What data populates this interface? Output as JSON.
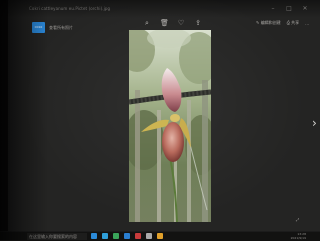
{
  "window": {
    "file_name": "Cokri cattleyanum eu.Pictet (orchi).jpg",
    "controls": [
      "minimize-icon",
      "maximize-icon",
      "close-icon"
    ]
  },
  "toolbar": {
    "icons": [
      "zoom-icon",
      "delete-icon",
      "favorite-icon",
      "share-icon"
    ],
    "album_tile_text": "0010",
    "album_label": "查看所有照片",
    "actions": [
      {
        "icon": "edit-icon",
        "label": "编辑和创建"
      },
      {
        "icon": "print-icon",
        "label": "共享"
      },
      {
        "icon": "more-icon",
        "label": "..."
      }
    ]
  },
  "viewer": {
    "next_arrow_icon": "chevron-right-icon",
    "zoom_icon": "fit-icon"
  },
  "taskbar": {
    "search_placeholder": "在这里输入你要搜索的内容",
    "apps": [
      {
        "icon": "file-explorer-icon",
        "color": "#2b8ad8"
      },
      {
        "icon": "edge-icon",
        "color": "#2f9fd9"
      },
      {
        "icon": "store-icon",
        "color": "#3aa55a"
      },
      {
        "icon": "mail-icon",
        "color": "#2a7ed0"
      },
      {
        "icon": "photos-icon",
        "color": "#c83b3b"
      },
      {
        "icon": "settings-icon",
        "color": "#aaaaaa"
      },
      {
        "icon": "browser-icon",
        "color": "#e1a02a"
      }
    ],
    "time": "13:28",
    "date": "2021/9/19"
  },
  "colors": {
    "window_bg": "#242423",
    "accent": "#2a86d6",
    "taskbar_bg": "#121211"
  }
}
